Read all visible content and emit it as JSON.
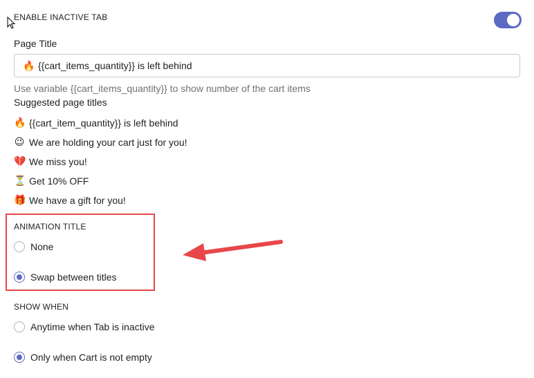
{
  "enable_tab": {
    "heading": "ENABLE INACTIVE TAB",
    "toggle_on": true,
    "accent": "#5c6ac4"
  },
  "page_title": {
    "label": "Page Title",
    "input_emoji": "🔥",
    "input_value": "{{cart_items_quantity}} is left behind",
    "help": "Use variable {{cart_items_quantity}} to show number of the cart items"
  },
  "suggested": {
    "heading": "Suggested page titles",
    "items": [
      {
        "emoji": "🔥",
        "text": "{{cart_item_quantity}} is left behind"
      },
      {
        "emoji": "😉",
        "text": "We are holding your cart just for you!"
      },
      {
        "emoji": "💔",
        "text": "We miss you!"
      },
      {
        "emoji": "⏳",
        "text": "Get 10% OFF"
      },
      {
        "emoji": "🎁",
        "text": "We have a gift for you!"
      }
    ]
  },
  "animation": {
    "heading": "ANIMATION TITLE",
    "options": [
      {
        "label": "None",
        "checked": false
      },
      {
        "label": "Swap between titles",
        "checked": true
      }
    ],
    "highlight_color": "#e8474a"
  },
  "show_when": {
    "heading": "SHOW WHEN",
    "options": [
      {
        "label": "Anytime when Tab is inactive",
        "checked": false
      },
      {
        "label": "Only when Cart is not empty",
        "checked": true
      }
    ]
  }
}
